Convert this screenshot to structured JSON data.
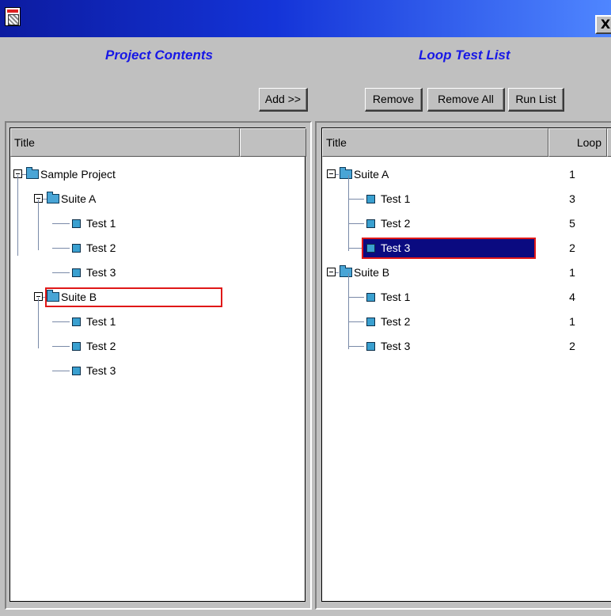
{
  "window": {
    "close_glyph": "X",
    "app_icon": "app-icon"
  },
  "left": {
    "heading": "Project Contents",
    "add_button": "Add >>",
    "column_title": "Title",
    "tree": [
      {
        "label": "Sample Project",
        "kind": "folder"
      },
      {
        "label": "Suite A",
        "kind": "folder"
      },
      {
        "label": "Test 1",
        "kind": "test"
      },
      {
        "label": "Test 2",
        "kind": "test"
      },
      {
        "label": "Test 3",
        "kind": "test"
      },
      {
        "label": "Suite B",
        "kind": "folder",
        "highlighted": true
      },
      {
        "label": "Test 1",
        "kind": "test"
      },
      {
        "label": "Test 2",
        "kind": "test"
      },
      {
        "label": "Test 3",
        "kind": "test"
      }
    ]
  },
  "right": {
    "heading": "Loop Test List",
    "buttons": {
      "remove": "Remove",
      "remove_all": "Remove All",
      "run_list": "Run List"
    },
    "column_title": "Title",
    "column_loop": "Loop",
    "rows": [
      {
        "label": "Suite A",
        "kind": "folder",
        "loop": "1"
      },
      {
        "label": "Test 1",
        "kind": "test",
        "loop": "3"
      },
      {
        "label": "Test 2",
        "kind": "test",
        "loop": "5"
      },
      {
        "label": "Test 3",
        "kind": "test",
        "loop": "2",
        "selected": true
      },
      {
        "label": "Suite B",
        "kind": "folder",
        "loop": "1"
      },
      {
        "label": "Test 1",
        "kind": "test",
        "loop": "4"
      },
      {
        "label": "Test 2",
        "kind": "test",
        "loop": "1"
      },
      {
        "label": "Test 3",
        "kind": "test",
        "loop": "2"
      }
    ]
  },
  "colors": {
    "heading": "#1818e6",
    "selection": "#0a0a80",
    "highlight_border": "#e01818"
  }
}
